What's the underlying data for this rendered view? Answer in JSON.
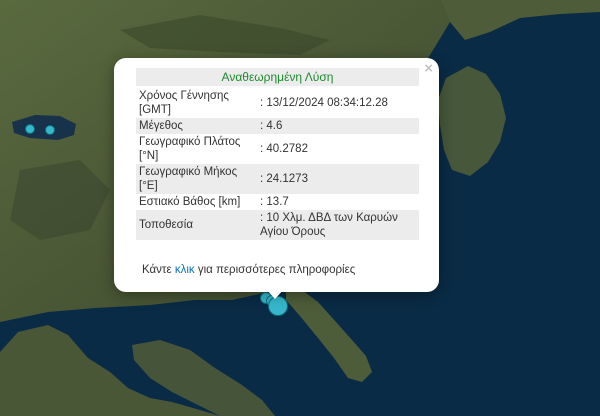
{
  "popup": {
    "title": "Αναθεωρημένη Λύση",
    "close_label": "×",
    "rows": [
      {
        "label": "Χρόνος Γέννησης [GMT]",
        "value": ": 13/12/2024 08:34:12.28"
      },
      {
        "label": "Μέγεθος",
        "value": ": 4.6"
      },
      {
        "label": "Γεωγραφικό Πλάτος [°N]",
        "value": ": 40.2782"
      },
      {
        "label": "Γεωγραφικό Μήκος [°E]",
        "value": ": 24.1273"
      },
      {
        "label": "Εστιακό Βάθος [km]",
        "value": ": 13.7"
      },
      {
        "label": "Τοποθεσία",
        "value": ": 10 Χλμ. ΔΒΔ των Καρυών Αγίου Όρους"
      }
    ],
    "more_prefix": "Κάντε",
    "more_link": "κλικ",
    "more_suffix": "για περισσότερες πληροφορίες"
  },
  "colors": {
    "sea": "#0a2b45",
    "land": "#4b5a37",
    "marker_fill": "#36b7cc",
    "title_text": "#1e8a2e",
    "link": "#0a74b8"
  }
}
